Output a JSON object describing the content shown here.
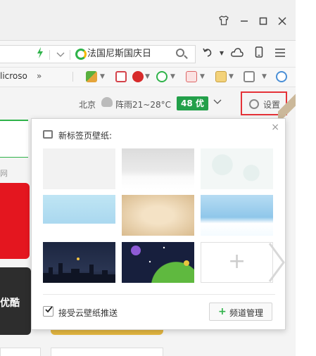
{
  "toolbar": {
    "search_text": "法国尼斯国庆日"
  },
  "bookmarks": {
    "partial_text": "licroso",
    "more": "»"
  },
  "weather": {
    "city": "北京",
    "condition": "阵雨21~28°C",
    "aqi": "48 优"
  },
  "settings": {
    "label": "设置"
  },
  "side": {
    "partial_word": "网",
    "dark_card_text": "优酷"
  },
  "popup": {
    "title": "新标签页壁纸:",
    "close": "×",
    "plus_tile": "+",
    "checkbox_label": "接受云壁纸推送",
    "checkbox_checked": true,
    "manage_button_plus": "+",
    "manage_button": "频道管理"
  },
  "colors": {
    "accent_green": "#2fb34a",
    "aqi_badge": "#23a04a",
    "highlight_red": "#e53238"
  },
  "icons": [
    "shirt-icon",
    "minimize-icon",
    "maximize-icon",
    "close-icon",
    "bolt-icon",
    "chevron-down-icon",
    "search-icon",
    "undo-icon",
    "cloud-icon",
    "phone-icon",
    "menu-icon",
    "gear-icon",
    "picture-icon",
    "check-icon",
    "plus-icon"
  ]
}
